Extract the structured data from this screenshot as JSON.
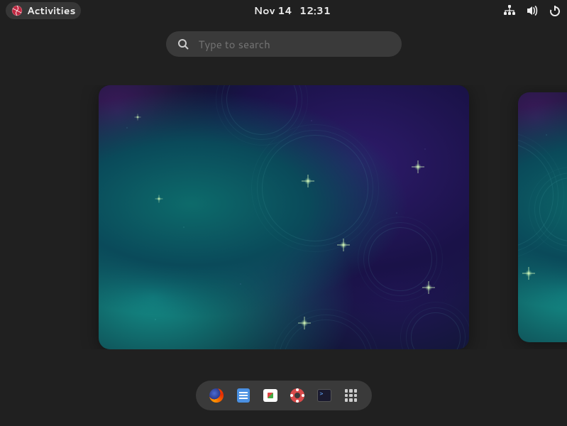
{
  "topbar": {
    "activities_label": "Activities",
    "date": "Nov 14",
    "time": "12:31"
  },
  "search": {
    "placeholder": "Type to search"
  },
  "dock": {
    "items": [
      "firefox",
      "files",
      "software",
      "help",
      "terminal",
      "show-applications"
    ]
  }
}
